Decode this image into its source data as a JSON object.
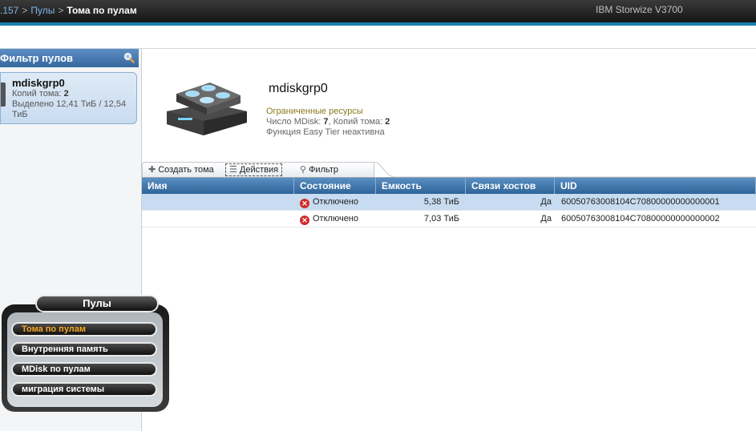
{
  "header": {
    "breadcrumb": {
      "part1": ".157",
      "part2": "Пулы",
      "current": "Тома по пулам",
      "sep": ">"
    },
    "product": "IBM Storwize V3700"
  },
  "sidebar": {
    "filter_title": "Фильтр пулов",
    "pool": {
      "name": "mdiskgrp0",
      "copies_label": "Копий тома:",
      "copies_value": "2",
      "allocated": "Выделено 12,41 ТиБ / 12,54",
      "allocated_unit": "ТиБ"
    }
  },
  "pool_detail": {
    "title": "mdiskgrp0",
    "status": "Ограниченные ресурсы",
    "mdisk_label": "Число MDisk:",
    "mdisk_value": "7",
    "copies_label": ", Копий тома:",
    "copies_value": "2",
    "easytier": "Функция Easy Tier неактивна"
  },
  "toolbar": {
    "create": "Создать тома",
    "actions": "Действия",
    "filter": "Фильтр"
  },
  "table": {
    "columns": [
      "Имя",
      "Состояние",
      "Емкость",
      "Связи хостов",
      "UID"
    ],
    "rows": [
      {
        "name": "",
        "state": "Отключено",
        "capacity": "5,38 ТиБ",
        "host": "Да",
        "uid": "60050763008104C70800000000000001"
      },
      {
        "name": "",
        "state": "Отключено",
        "capacity": "7,03 ТиБ",
        "host": "Да",
        "uid": "60050763008104C70800000000000002"
      }
    ]
  },
  "nav": {
    "title": "Пулы",
    "items": [
      "Тома по пулам",
      "Внутренняя память",
      "MDisk по пулам",
      "миграция системы"
    ]
  },
  "colors": {
    "accent": "#1a7fb0",
    "header_blue": "#36679d",
    "active_nav": "#f5a623",
    "error": "#d22b2b"
  }
}
